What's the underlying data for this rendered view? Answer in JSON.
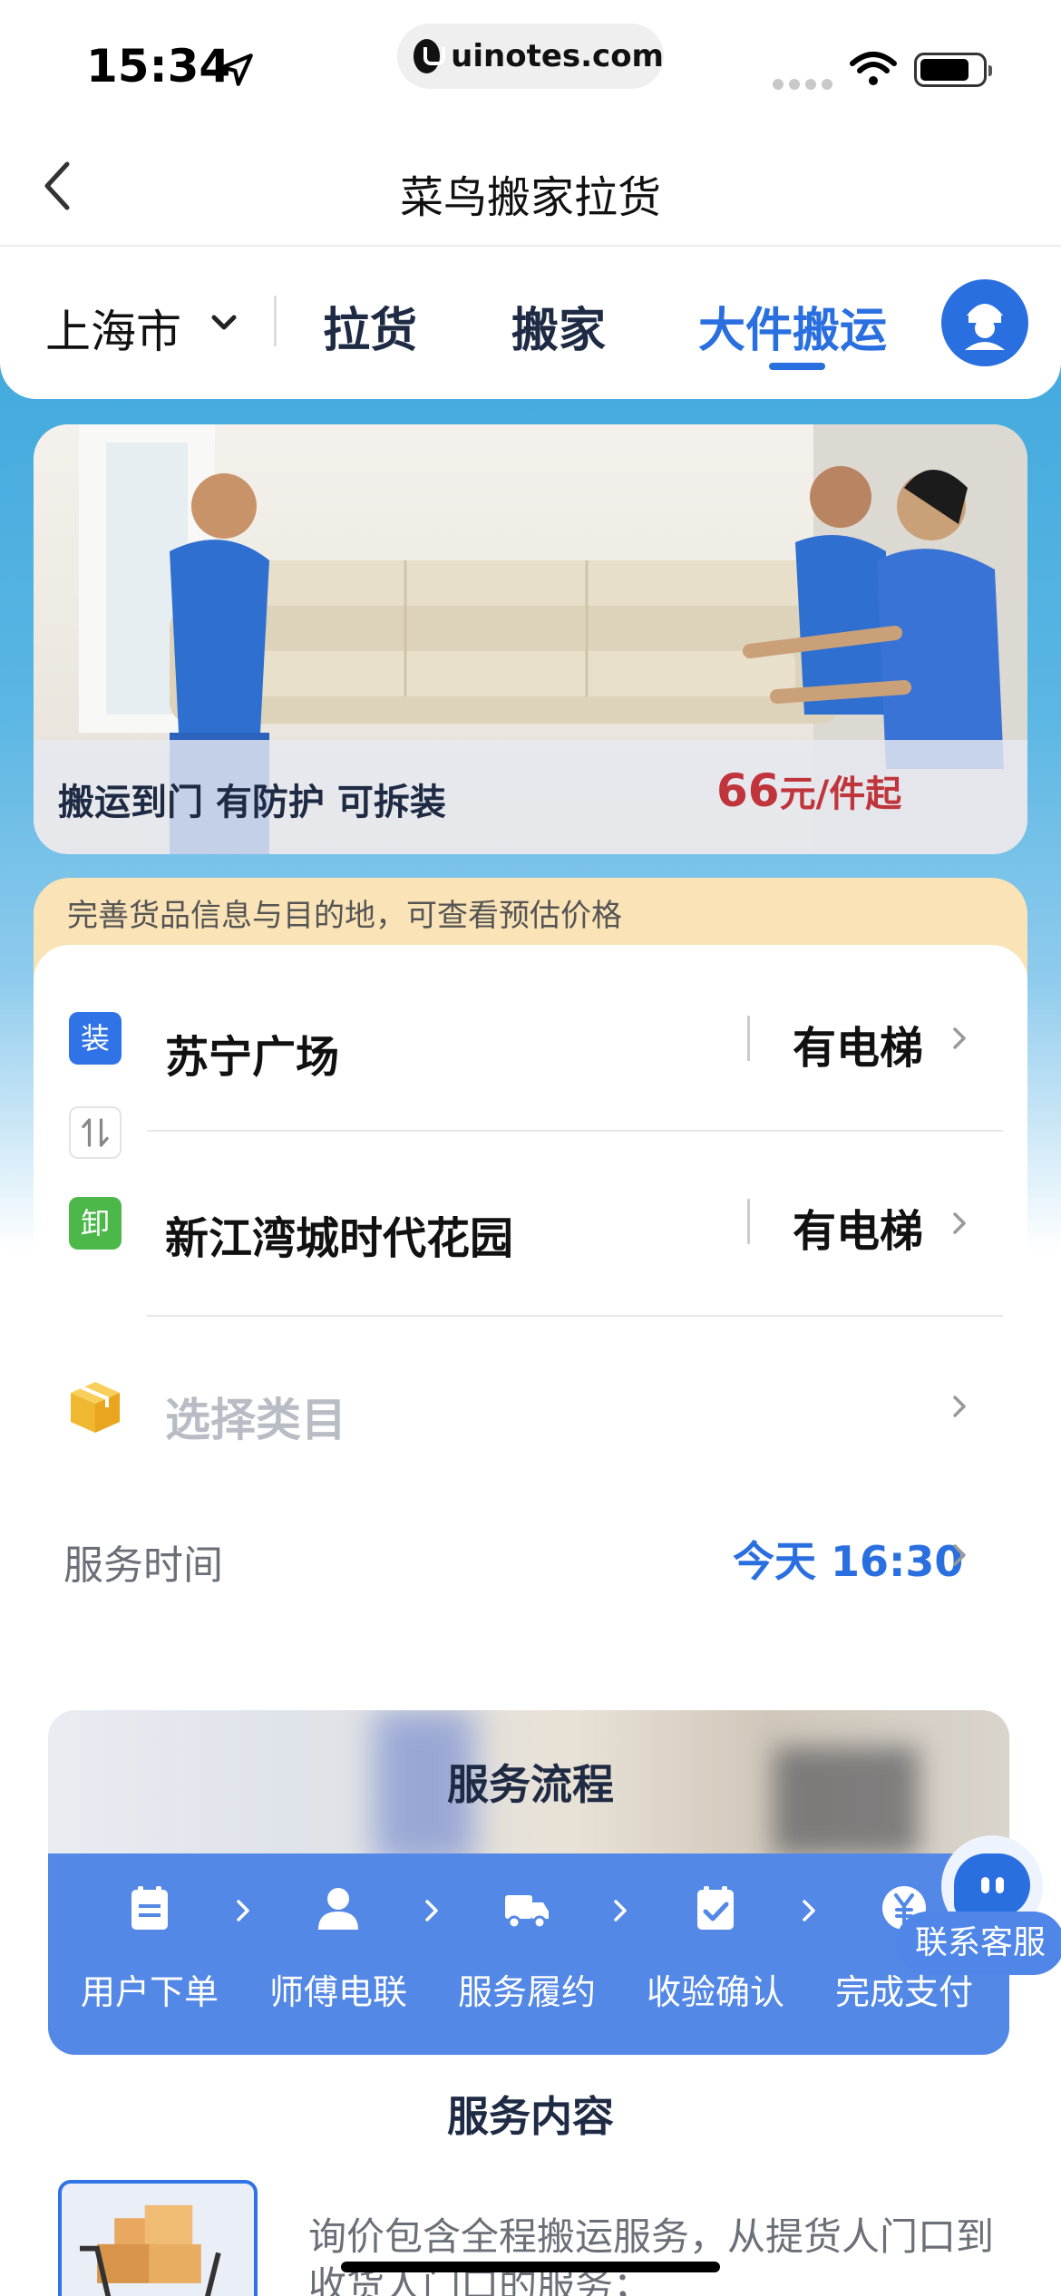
{
  "status_bar": {
    "time": "15:34",
    "url": "uinotes.com"
  },
  "nav": {
    "title": "菜鸟搬家拉货"
  },
  "tabs_bar": {
    "city": "上海市",
    "tabs": [
      {
        "label": "拉货",
        "active": false
      },
      {
        "label": "搬家",
        "active": false
      },
      {
        "label": "大件搬运",
        "active": true
      }
    ],
    "accent_color": "#2a6fe0"
  },
  "banner": {
    "text": "搬运到门 有防护 可拆装",
    "price_amount": "66",
    "price_unit": "元/件起"
  },
  "form": {
    "notice": "完善货品信息与目的地，可查看预估价格",
    "load_tag": "装",
    "unload_tag": "卸",
    "load_address": "苏宁广场",
    "unload_address": "新江湾城时代花园",
    "load_elevator": "有电梯",
    "unload_elevator": "有电梯",
    "category_placeholder": "选择类目",
    "service_time_label": "服务时间",
    "service_time_value": "今天 16:30"
  },
  "process": {
    "title": "服务流程",
    "steps": [
      {
        "label": "用户下单",
        "icon": "order-icon"
      },
      {
        "label": "师傅电联",
        "icon": "person-icon"
      },
      {
        "label": "服务履约",
        "icon": "truck-icon"
      },
      {
        "label": "收验确认",
        "icon": "checklist-icon"
      },
      {
        "label": "完成支付",
        "icon": "yuan-icon"
      }
    ]
  },
  "content": {
    "title": "服务内容",
    "description": "询价包含全程搬运服务，从提货人门口到收货人门口的服务；"
  },
  "floating_service": {
    "label": "联系客服"
  }
}
